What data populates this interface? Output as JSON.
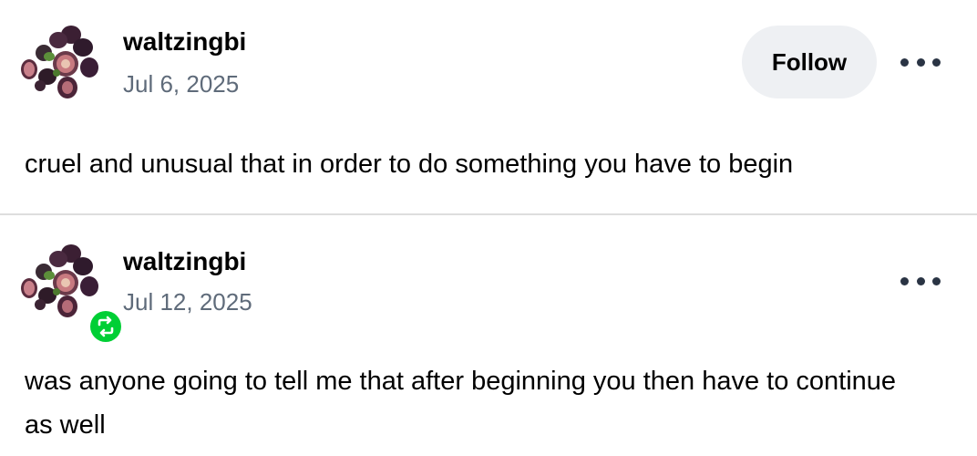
{
  "posts": [
    {
      "username": "waltzingbi",
      "date": "Jul 6, 2025",
      "follow_label": "Follow",
      "body": "cruel and unusual that in order to do something you have to begin",
      "avatar_icon": "fig-cluster-avatar",
      "more_icon": "ellipsis-icon"
    },
    {
      "username": "waltzingbi",
      "date": "Jul 12, 2025",
      "body": "was anyone going to tell me that after beginning you then have to continue as well",
      "avatar_icon": "fig-cluster-avatar",
      "badge_icon": "reblog-icon",
      "more_icon": "ellipsis-icon"
    }
  ],
  "colors": {
    "follow_bg": "#eef0f3",
    "date_text": "#5f6b7a",
    "reblog_green": "#00cf35",
    "divider": "#dedede"
  }
}
